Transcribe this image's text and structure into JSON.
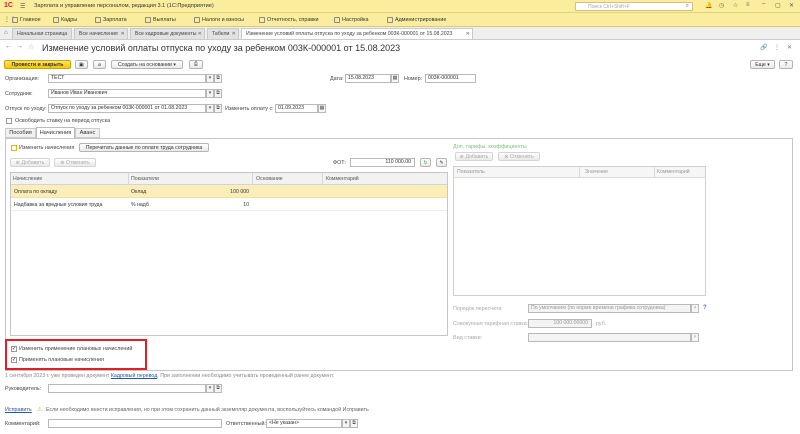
{
  "app": {
    "title": "Зарплата и управление персоналом, редакция 3.1  (1С:Предприятие)",
    "search_placeholder": "Поиск Ctrl+Shift+F",
    "logo": "1С"
  },
  "menu": [
    "Главное",
    "Кадры",
    "Зарплата",
    "Выплаты",
    "Налоги и взносы",
    "Отчетность, справки",
    "Настройка",
    "Администрирование"
  ],
  "tabs": [
    {
      "label": "Начальная страница"
    },
    {
      "label": "Все начисления"
    },
    {
      "label": "Все кадровые документы"
    },
    {
      "label": "Табели"
    },
    {
      "label": "Изменение условий оплаты отпуска по уходу за ребенком 003К-000001 от 15.08.2023"
    }
  ],
  "doc": {
    "title": "Изменение условий оплаты отпуска по уходу за ребенком 003К-000001 от 15.08.2023"
  },
  "toolbar": {
    "post_close": "Провести и закрыть",
    "create_basis": "Создать на основании",
    "more": "Еще"
  },
  "form": {
    "org_label": "Организация:",
    "org_value": "ТЕСТ",
    "date_label": "Дата:",
    "date_value": "15.08.2023",
    "number_label": "Номер:",
    "number_value": "003К-000001",
    "employee_label": "Сотрудник:",
    "employee_value": "Иванов Иван Иванович",
    "leave_label": "Отпуск по уходу:",
    "leave_value": "Отпуск по уходу за ребенком 003К-000001 от 01.08.2023",
    "change_from_label": "Изменить оплату с:",
    "change_from_value": "01.09.2023",
    "release_rate_label": "Освободить ставку на период отпуска"
  },
  "form_tabs": [
    "Пособия",
    "Начисления",
    "Аванс"
  ],
  "accruals": {
    "change_label": "Изменить начисления",
    "recalc_btn": "Перечитать данные по оплате труда сотрудника",
    "add_btn": "Добавить",
    "cancel_btn": "Отменить",
    "fot_label": "ФОТ:",
    "fot_value": "110 000.00",
    "columns": [
      "Начисление",
      "Показатели",
      "Основание",
      "Комментарий"
    ],
    "rows": [
      {
        "name": "Оплата по окладу",
        "indicator": "Оклад",
        "value": "100 000"
      },
      {
        "name": "Надбавка за вредные условия труда",
        "indicator": "% надб",
        "value": "10"
      }
    ]
  },
  "right": {
    "title": "Доп. тарифы, коэффициенты",
    "add_btn": "Добавить",
    "cancel_btn": "Отменить",
    "columns": [
      "Показатель",
      "Значение",
      "Комментарий"
    ],
    "recalc_order_label": "Порядок пересчета:",
    "recalc_order_value": "По умолчанию (по норме времени графика сотрудника)",
    "total_rate_label": "Совокупная тарифная ставка:",
    "total_rate_value": "100 000.00000",
    "total_rate_unit": "руб.",
    "rate_type_label": "Вид ставки:"
  },
  "planned": {
    "change_label": "Изменить применение плановых начислений",
    "apply_label": "Применять плановые начисления"
  },
  "info": {
    "prefix": "1 сентября 2023 г. уже проведен документ ",
    "link": "Кадровый перевод",
    "suffix": ". При заполнении необходимо учитывать проведенный ранее документ."
  },
  "bottom": {
    "manager_label": "Руководитель:",
    "fix_link": "Исправить",
    "fix_note": "Если необходимо внести исправления, но при этом сохранить данный экземпляр документа, воспользуйтесь командой Исправить",
    "comment_label": "Комментарий:",
    "responsible_label": "Ответственный:",
    "responsible_value": "<Не указан>"
  },
  "colors": {
    "header_bg": "#fbed9e",
    "accent": "#e3b800",
    "highlight": "#e31e24",
    "selected_row": "#fbeeb9"
  }
}
